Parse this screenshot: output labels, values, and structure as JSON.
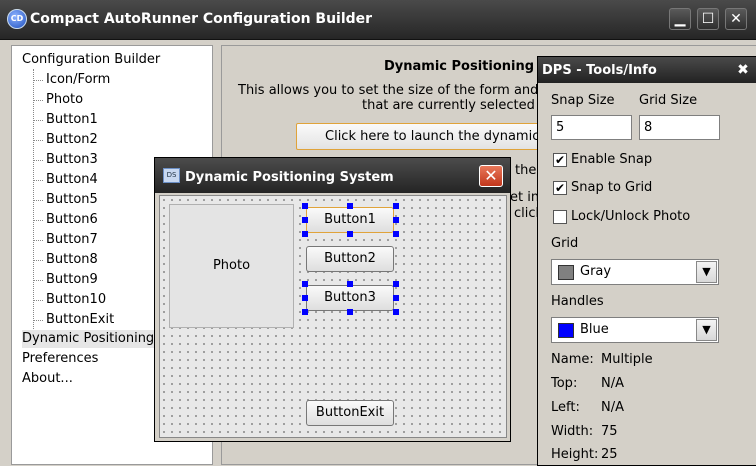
{
  "window": {
    "title": "Compact AutoRunner Configuration Builder",
    "icon_text": "CD",
    "minimize_glyph": "▁",
    "maximize_glyph": "☐",
    "close_glyph": "✕"
  },
  "tree": {
    "root": "Configuration Builder",
    "children": [
      "Icon/Form",
      "Photo",
      "Button1",
      "Button2",
      "Button3",
      "Button4",
      "Button5",
      "Button6",
      "Button7",
      "Button8",
      "Button9",
      "Button10",
      "ButtonExit"
    ],
    "others": [
      "Dynamic Positioning Sy",
      "Preferences",
      "About..."
    ]
  },
  "panel": {
    "heading": "Dynamic Positioning S",
    "desc_line1": "This allows you to set the size of the form and the",
    "desc_line2": "that are currently selected to",
    "launch_button": "Click here to launch the dynamic pos",
    "frag1": "the",
    "frag2": "et int",
    "frag3": "click"
  },
  "dps": {
    "title": "Dynamic Positioning System",
    "icon_text": "DS",
    "close_glyph": "✕",
    "photo_label": "Photo",
    "buttons": {
      "b1": "Button1",
      "b2": "Button2",
      "b3": "Button3",
      "exit": "ButtonExit"
    }
  },
  "tools": {
    "title": "DPS - Tools/Info",
    "close_glyph": "✖",
    "snap_size_label": "Snap Size",
    "grid_size_label": "Grid Size",
    "snap_size_value": "5",
    "grid_size_value": "8",
    "enable_snap": "Enable Snap",
    "snap_to_grid": "Snap to Grid",
    "lock_photo": "Lock/Unlock Photo",
    "check_glyph": "✔",
    "grid_label": "Grid",
    "grid_value": "Gray",
    "grid_color": "#808080",
    "handles_label": "Handles",
    "handles_value": "Blue",
    "handles_color": "#0000ff",
    "arrow_glyph": "▼",
    "info": {
      "name_label": "Name:",
      "name_value": "Multiple",
      "top_label": "Top:",
      "top_value": "N/A",
      "left_label": "Left:",
      "left_value": "N/A",
      "width_label": "Width:",
      "width_value": "75",
      "height_label": "Height:",
      "height_value": "25"
    }
  }
}
